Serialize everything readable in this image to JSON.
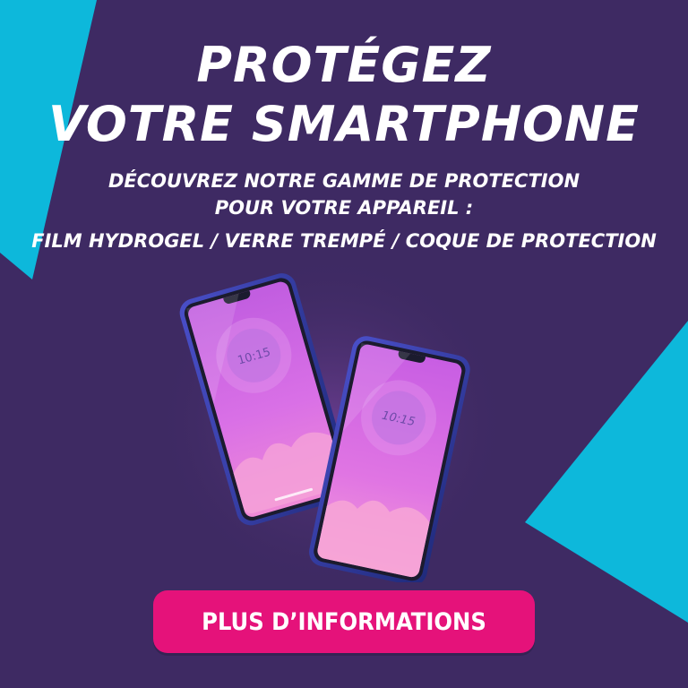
{
  "colors": {
    "background": "#3e2a63",
    "accent_cyan": "#0db8db",
    "button": "#e5127a",
    "text": "#ffffff"
  },
  "headline": {
    "line1": "PROTÉGEZ",
    "line2": "VOTRE SMARTPHONE"
  },
  "subheadline": {
    "line1": "DÉCOUVREZ NOTRE GAMME DE PROTECTION",
    "line2": "POUR VOTRE APPAREIL :",
    "line3": "FILM HYDROGEL / VERRE TREMPÉ / COQUE DE PROTECTION"
  },
  "phones": {
    "left_time": "10:15",
    "right_time": "10:15"
  },
  "cta": {
    "label": "PLUS D’INFORMATIONS"
  }
}
